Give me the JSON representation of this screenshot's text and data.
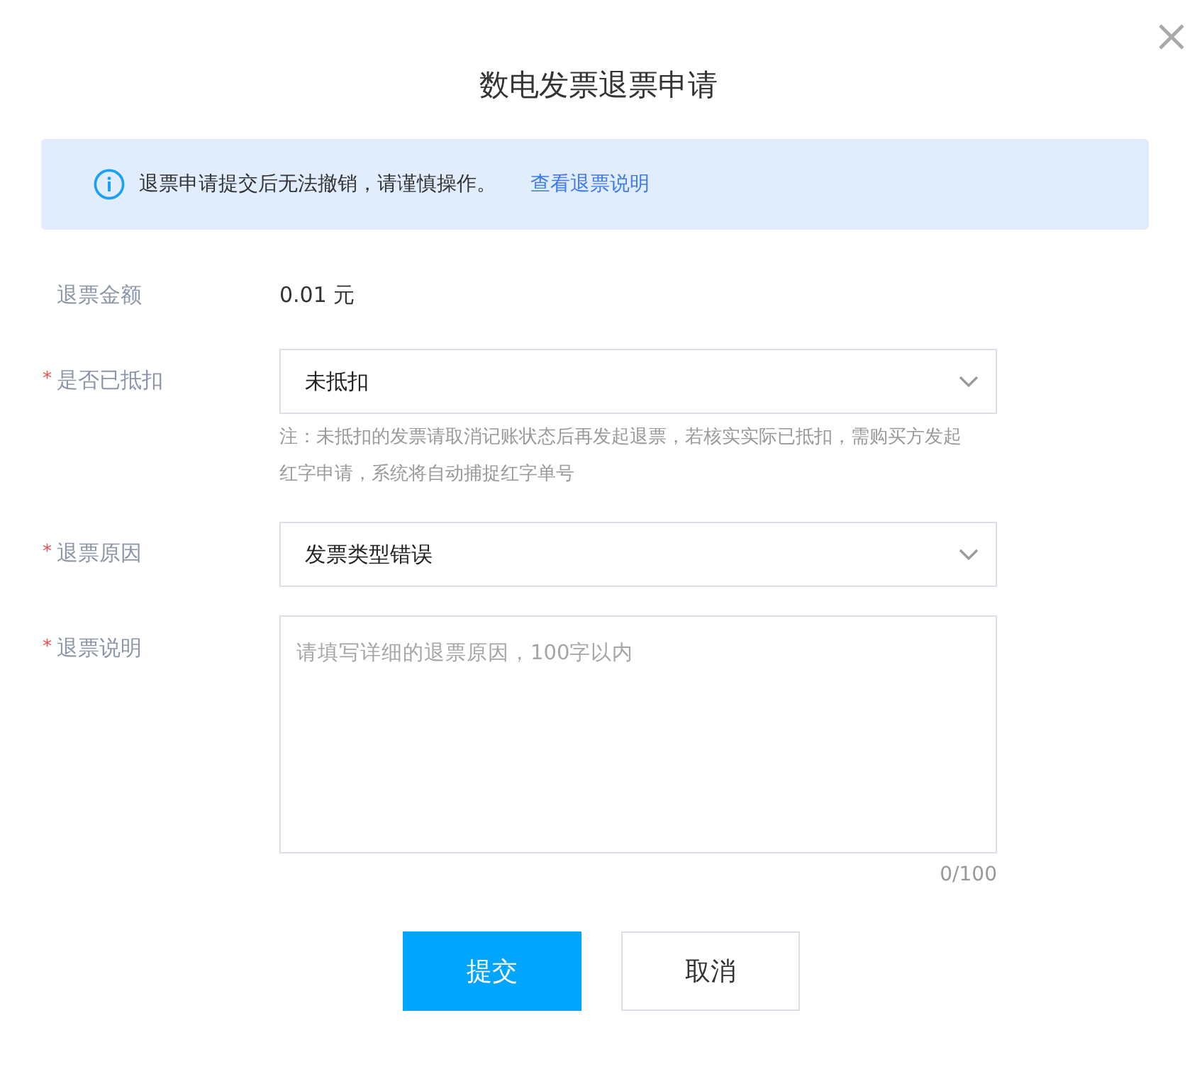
{
  "dialog": {
    "title": "数电发票退票申请"
  },
  "alert": {
    "message": "退票申请提交后无法撤销，请谨慎操作。",
    "link": "查看退票说明"
  },
  "fields": [
    {
      "kind": "text",
      "label": "退票金额",
      "value": "0.01 元"
    },
    {
      "kind": "select",
      "label": "是否已抵扣",
      "required_mark": "*",
      "value": "未抵扣",
      "note": "注：未抵扣的发票请取消记账状态后再发起退票，若核实实际已抵扣，需购买方发起红字申请，系统将自动捕捉红字单号"
    },
    {
      "kind": "select",
      "label": "退票原因",
      "required_mark": "*",
      "value": "发票类型错误"
    },
    {
      "kind": "textarea",
      "label": "退票说明",
      "required_mark": "*",
      "placeholder": "请填写详细的退票原因，100字以内",
      "counter": "0/100"
    }
  ],
  "buttons": [
    {
      "kind": "primary",
      "label": "提交"
    },
    {
      "kind": "default",
      "label": "取消"
    }
  ]
}
